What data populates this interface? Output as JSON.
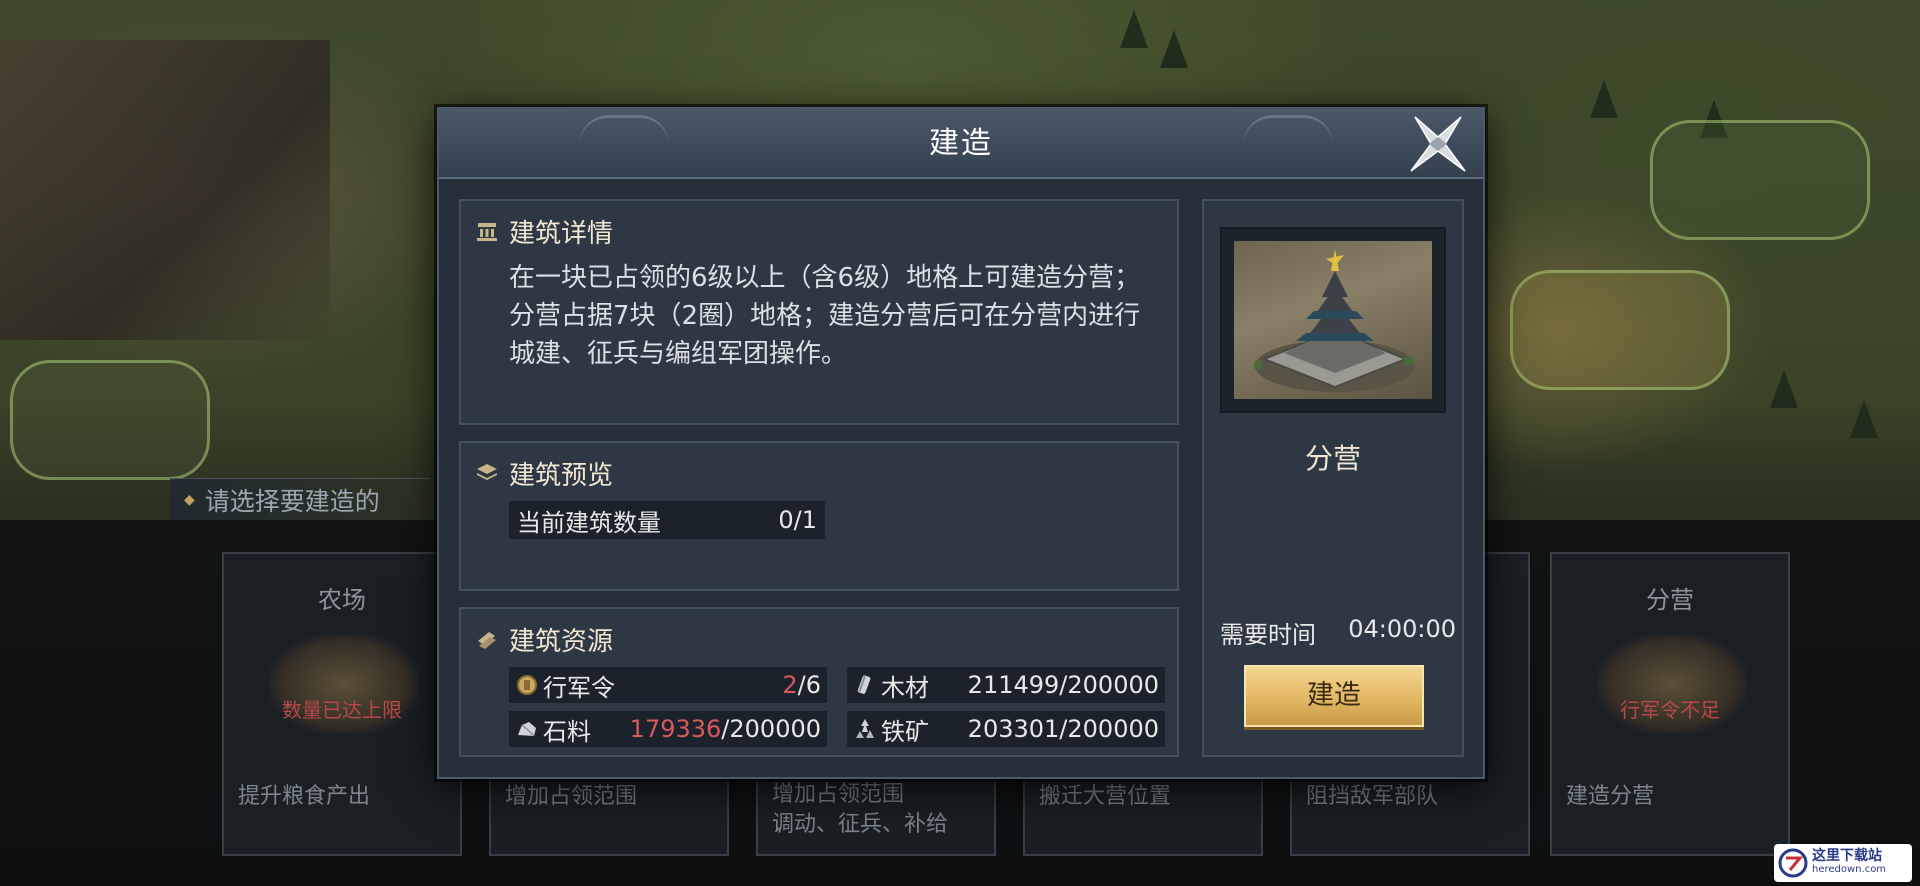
{
  "dialog": {
    "title": "建造"
  },
  "details": {
    "heading": "建筑详情",
    "lines": [
      "在一块已占领的6级以上（含6级）地格上可建造分营；",
      "分营占据7块（2圈）地格；建造分营后可在分营内进行",
      "城建、征兵与编组军团操作。"
    ]
  },
  "preview": {
    "heading": "建筑预览",
    "count_label": "当前建筑数量",
    "count_value": "0/1"
  },
  "resources": {
    "heading": "建筑资源",
    "items": [
      {
        "icon": "march-order-icon",
        "label": "行军令",
        "current": "2",
        "required": "/6",
        "insufficient": true
      },
      {
        "icon": "wood-icon",
        "label": "木材",
        "current": "211499",
        "required": "/200000",
        "insufficient": false
      },
      {
        "icon": "stone-icon",
        "label": "石料",
        "current": "179336",
        "required": "/200000",
        "insufficient": true
      },
      {
        "icon": "iron-ore-icon",
        "label": "铁矿",
        "current": "203301",
        "required": "/200000",
        "insufficient": false
      }
    ]
  },
  "side": {
    "building_name": "分营",
    "time_label": "需要时间",
    "time_value": "04:00:00",
    "build_button": "建造"
  },
  "background": {
    "hint": "请选择要建造的",
    "cards": [
      {
        "name": "农场",
        "warning": "数量已达上限",
        "desc": "提升粮食产出"
      },
      {
        "name": "",
        "warning": "",
        "desc": "增加占领范围"
      },
      {
        "name": "",
        "warning": "",
        "desc": "增加占领范围\n调动、征兵、补给"
      },
      {
        "name": "",
        "warning": "",
        "desc": "搬迁大营位置"
      },
      {
        "name": "",
        "warning": "",
        "desc": "阻挡敌军部队"
      },
      {
        "name": "分营",
        "warning": "行军令不足",
        "desc": "建造分营"
      }
    ]
  },
  "watermark": {
    "cn": "这里下载站",
    "en": "heredown.com"
  },
  "colors": {
    "insufficient": "#d85a5a",
    "gold_button": "#e2b864",
    "dialog_bg": "#262f3a"
  }
}
